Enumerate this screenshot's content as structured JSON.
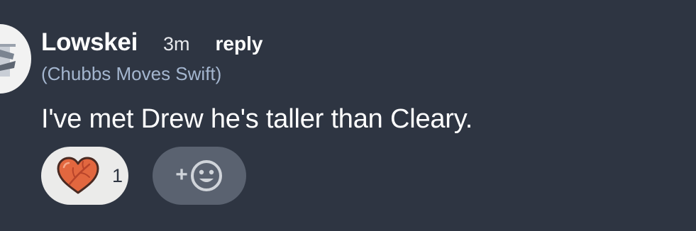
{
  "comment": {
    "username": "Lowskei",
    "time": "3m",
    "reply_label": "reply",
    "flair": "(Chubbs Moves Swift)",
    "text": "I've met Drew he's taller than Cleary."
  },
  "reactions": [
    {
      "icon": "heart-icon",
      "count": "1"
    }
  ],
  "add_reaction": {
    "plus": "+",
    "icon": "smiley-icon"
  },
  "colors": {
    "background": "#2e3542",
    "flair": "#a4b6cf",
    "reaction_pill": "#ebebea",
    "add_reaction_pill": "#5a6270",
    "heart": "#e2673f"
  }
}
